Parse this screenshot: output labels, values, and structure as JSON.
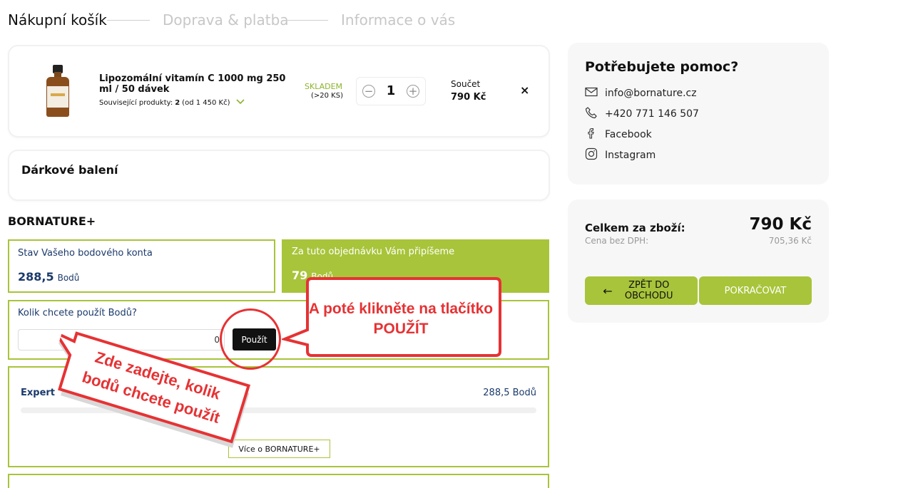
{
  "steps": {
    "cart": "Nákupní košík",
    "shipping": "Doprava & platba",
    "info": "Informace o vás"
  },
  "product": {
    "name": "Lipozomální vitamín C 1000 mg 250 ml / 50 dávek",
    "related_prefix": "Související produkty:",
    "related_count": "2",
    "related_from": "(od 1 450 Kč)",
    "stock_status": "SKLADEM",
    "stock_count": "(>20 KS)",
    "quantity": "1",
    "sum_label": "Součet",
    "sum_value": "790 Kč",
    "remove": "×"
  },
  "gift": {
    "title": "Dárkové balení"
  },
  "bornature": {
    "title": "BORNATURE+",
    "balance_label": "Stav Vašeho bodového konta",
    "balance_value": "288,5",
    "balance_unit": "Bodů",
    "earn_label": "Za tuto objednávku Vám připíšeme",
    "earn_value": "79",
    "earn_unit": "Bodů",
    "use_label": "Kolik chcete použít Bodů?",
    "use_input_value": "0",
    "use_button": "Použít",
    "level_name": "Expert",
    "level_points": "288,5 Bodů",
    "level_progress": 0,
    "more_button": "Více o BORNATURE+"
  },
  "help": {
    "title": "Potřebujete pomoc?",
    "email": "info@bornature.cz",
    "phone": "+420 771 146 507",
    "facebook": "Facebook",
    "instagram": "Instagram"
  },
  "summary": {
    "total_label": "Celkem za zboží:",
    "total_value": "790 Kč",
    "net_label": "Cena bez DPH:",
    "net_value": "705,36 Kč",
    "back_button": "ZPĚT DO OBCHODU",
    "continue_button": "POKRAČOVAT"
  },
  "annotations": {
    "click_text": "A poté klikněte na tlačítko POUŽÍT",
    "enter_text": "Zde zadejte, kolik bodů chcete použít"
  },
  "colors": {
    "accent_green": "#a8c43a",
    "navy": "#1b3a6b",
    "annotation_red": "#e63234"
  }
}
